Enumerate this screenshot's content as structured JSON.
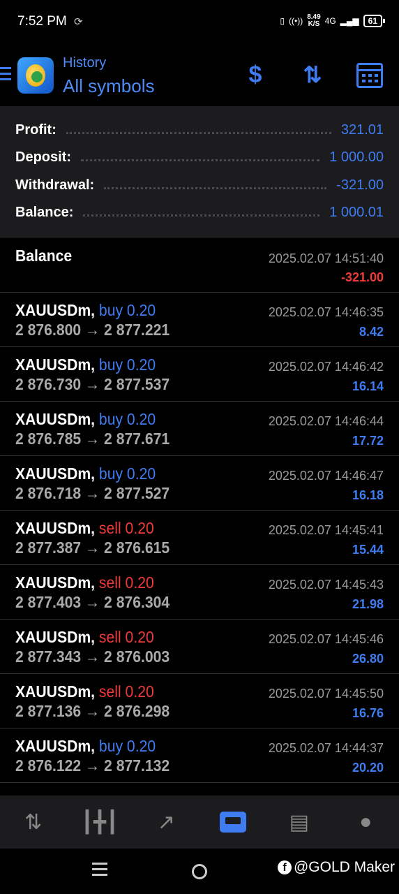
{
  "status_bar": {
    "time": "7:52 PM",
    "net_speed": "8.49",
    "net_unit": "K/S",
    "network": "4G",
    "battery": "61"
  },
  "header": {
    "title": "History",
    "subtitle": "All symbols"
  },
  "summary": [
    {
      "label": "Profit:",
      "value": "321.01"
    },
    {
      "label": "Deposit:",
      "value": "1 000.00"
    },
    {
      "label": "Withdrawal:",
      "value": "-321.00"
    },
    {
      "label": "Balance:",
      "value": "1 000.01"
    }
  ],
  "balance_entry": {
    "label": "Balance",
    "date": "2025.02.07 14:51:40",
    "amount": "-321.00"
  },
  "deals": [
    {
      "symbol": "XAUUSDm,",
      "type": "buy 0.20",
      "side": "buy",
      "open": "2 876.800",
      "close": "2 877.221",
      "date": "2025.02.07 14:46:35",
      "profit": "8.42"
    },
    {
      "symbol": "XAUUSDm,",
      "type": "buy 0.20",
      "side": "buy",
      "open": "2 876.730",
      "close": "2 877.537",
      "date": "2025.02.07 14:46:42",
      "profit": "16.14"
    },
    {
      "symbol": "XAUUSDm,",
      "type": "buy 0.20",
      "side": "buy",
      "open": "2 876.785",
      "close": "2 877.671",
      "date": "2025.02.07 14:46:44",
      "profit": "17.72"
    },
    {
      "symbol": "XAUUSDm,",
      "type": "buy 0.20",
      "side": "buy",
      "open": "2 876.718",
      "close": "2 877.527",
      "date": "2025.02.07 14:46:47",
      "profit": "16.18"
    },
    {
      "symbol": "XAUUSDm,",
      "type": "sell 0.20",
      "side": "sell",
      "open": "2 877.387",
      "close": "2 876.615",
      "date": "2025.02.07 14:45:41",
      "profit": "15.44"
    },
    {
      "symbol": "XAUUSDm,",
      "type": "sell 0.20",
      "side": "sell",
      "open": "2 877.403",
      "close": "2 876.304",
      "date": "2025.02.07 14:45:43",
      "profit": "21.98"
    },
    {
      "symbol": "XAUUSDm,",
      "type": "sell 0.20",
      "side": "sell",
      "open": "2 877.343",
      "close": "2 876.003",
      "date": "2025.02.07 14:45:46",
      "profit": "26.80"
    },
    {
      "symbol": "XAUUSDm,",
      "type": "sell 0.20",
      "side": "sell",
      "open": "2 877.136",
      "close": "2 876.298",
      "date": "2025.02.07 14:45:50",
      "profit": "16.76"
    },
    {
      "symbol": "XAUUSDm,",
      "type": "buy 0.20",
      "side": "buy",
      "open": "2 876.122",
      "close": "2 877.132",
      "date": "2025.02.07 14:44:37",
      "profit": "20.20"
    }
  ],
  "price_arrow": "→",
  "bottom_nav": [
    "quotes-icon",
    "chart-icon",
    "trade-icon",
    "history-icon",
    "news-icon",
    "messages-icon"
  ],
  "watermark": "@GOLD Maker",
  "colors": {
    "accent": "#3f7cf2",
    "loss": "#f03a3a",
    "background": "#000000",
    "panel": "#1c1c1e"
  }
}
